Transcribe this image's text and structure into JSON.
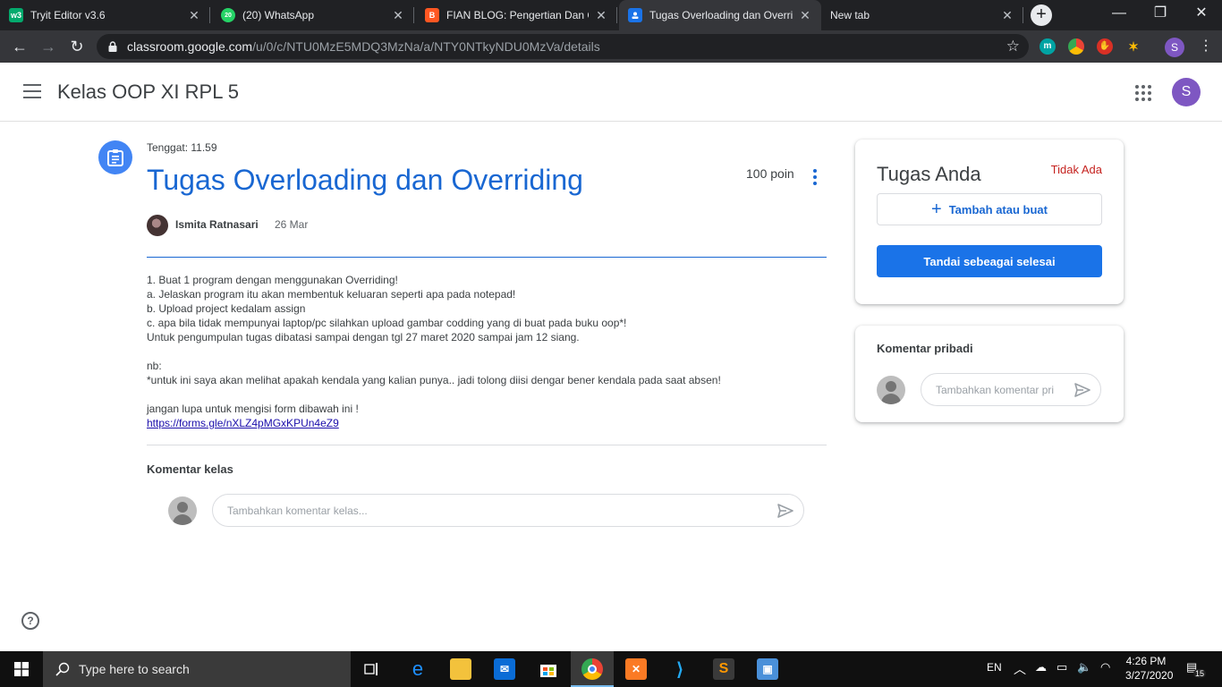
{
  "browser": {
    "tabs": [
      {
        "title": "Tryit Editor v3.6",
        "icon": "w3schools-icon",
        "color": "#04aa6d",
        "glyph": "w3"
      },
      {
        "title": "(20) WhatsApp",
        "icon": "whatsapp-icon",
        "color": "#25d366",
        "glyph": "20"
      },
      {
        "title": "FIAN BLOG: Pengertian Dan Co",
        "icon": "blogger-icon",
        "color": "#ff5722",
        "glyph": "B"
      },
      {
        "title": "Tugas Overloading dan Overrid",
        "icon": "classroom-icon",
        "color": "#1a73e8",
        "glyph": "C"
      },
      {
        "title": "New tab",
        "icon": "",
        "color": "",
        "glyph": ""
      }
    ],
    "url_host": "classroom.google.com",
    "url_path": "/u/0/c/NTU0MzE5MDQ3MzNa/a/NTY0NTkyNDU0MzVa/details",
    "profile_initial": "S"
  },
  "app": {
    "class_name": "Kelas OOP XI RPL 5",
    "user_initial": "S"
  },
  "assignment": {
    "due": "Tenggat: 11.59",
    "title": "Tugas Overloading dan Overriding",
    "points": "100 poin",
    "author": "Ismita Ratnasari",
    "date": "26 Mar",
    "description_lines": [
      "1. Buat 1 program dengan menggunakan Overriding!",
      "a. Jelaskan program itu akan membentuk keluaran seperti apa pada notepad!",
      "b. Upload project kedalam assign",
      "c. apa bila tidak mempunyai laptop/pc silahkan upload gambar codding yang di buat pada buku oop*!",
      "Untuk pengumpulan tugas dibatasi sampai dengan tgl 27 maret 2020 sampai jam 12 siang.",
      "",
      "nb:",
      "*untuk ini saya akan melihat apakah kendala yang kalian punya.. jadi tolong diisi dengar bener kendala pada saat absen!",
      "",
      "jangan lupa untuk mengisi form dibawah ini !"
    ],
    "link": "https://forms.gle/nXLZ4pMGxKPUn4eZ9"
  },
  "class_comments": {
    "title": "Komentar kelas",
    "placeholder": "Tambahkan komentar kelas..."
  },
  "your_work": {
    "title": "Tugas Anda",
    "status": "Tidak Ada",
    "add_label": "Tambah atau buat",
    "mark_done_label": "Tandai sebeagai selesai"
  },
  "private_comments": {
    "title": "Komentar pribadi",
    "placeholder": "Tambahkan komentar pri"
  },
  "taskbar": {
    "search_placeholder": "Type here to search",
    "language": "EN",
    "time": "4:26 PM",
    "date": "3/27/2020",
    "notifications": "15"
  },
  "colors": {
    "accent": "#1967d2",
    "primary_button": "#1a73e8",
    "missing": "#c5221f"
  }
}
